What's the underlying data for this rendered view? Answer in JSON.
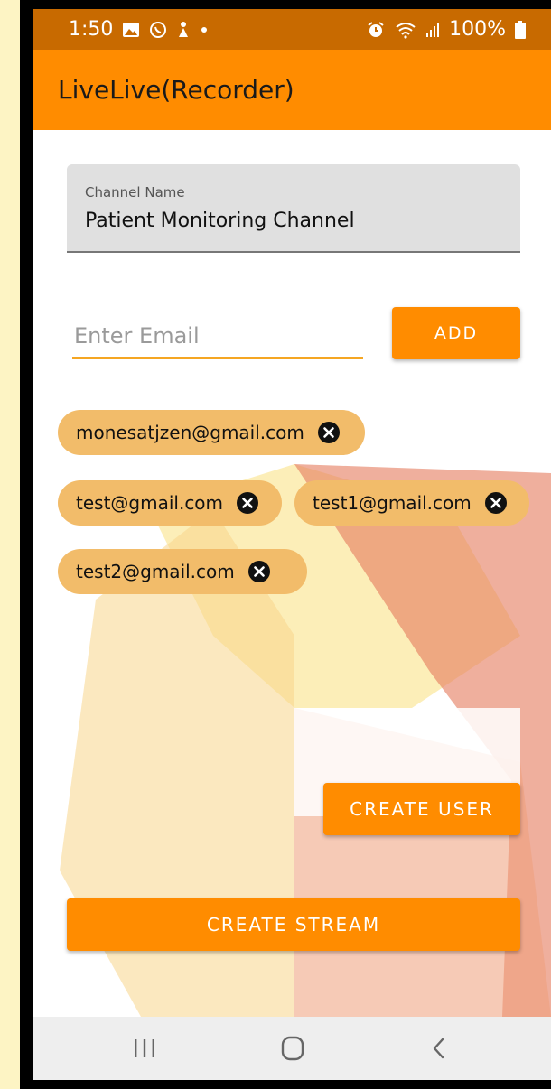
{
  "status_bar": {
    "time": "1:50",
    "battery": "100%",
    "icons_left": [
      "gallery-icon",
      "whatsapp-icon",
      "app-notification-icon",
      "dot-icon"
    ],
    "icons_right": [
      "alarm-icon",
      "wifi-icon",
      "signal-icon",
      "battery-icon"
    ]
  },
  "app_bar": {
    "title": "LiveLive(Recorder)"
  },
  "channel": {
    "label": "Channel Name",
    "value": "Patient Monitoring Channel"
  },
  "email": {
    "placeholder": "Enter Email",
    "value": ""
  },
  "buttons": {
    "add": "ADD",
    "create_user": "CREATE USER",
    "create_stream": "CREATE STREAM"
  },
  "chips": [
    {
      "email": "monesatjzen@gmail.com"
    },
    {
      "email": "test@gmail.com"
    },
    {
      "email": "test1@gmail.com"
    },
    {
      "email": "test2@gmail.com"
    }
  ],
  "nav": {
    "items": [
      "recent-apps-icon",
      "home-icon",
      "back-icon"
    ]
  },
  "colors": {
    "primary": "#ff8c00",
    "status_bar": "#c86a00",
    "chip": "#f2bc6a",
    "page_background": "#fdf4c4"
  }
}
